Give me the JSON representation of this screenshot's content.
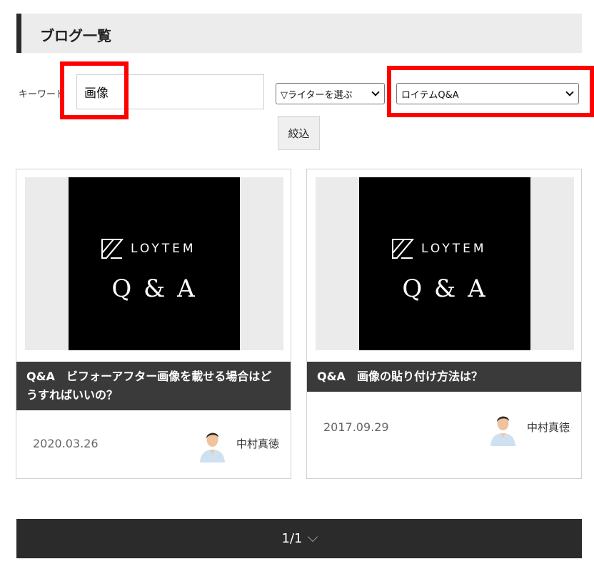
{
  "page": {
    "title": "ブログ一覧"
  },
  "filters": {
    "keyword_label": "キーワード",
    "keyword_value": "画像",
    "writer_select": "▽ライターを選ぶ",
    "category_select": "ロイテムQ&A",
    "filter_button": "絞込"
  },
  "posts": [
    {
      "thumb_brand": "LOYTEM",
      "thumb_caption": "Q & A",
      "title": "Q&A　ビフォーアフター画像を載せる場合はどうすればいいの？",
      "date": "2020.03.26",
      "author": "中村真徳"
    },
    {
      "thumb_brand": "LOYTEM",
      "thumb_caption": "Q & A",
      "title": "Q&A　画像の貼り付け方法は？",
      "date": "2017.09.29",
      "author": "中村真徳"
    }
  ],
  "pagination": {
    "label": "1/1"
  },
  "colors": {
    "highlight": "#ff0000",
    "dark_bar": "#3a3a3a",
    "pager": "#2b2b2b"
  }
}
